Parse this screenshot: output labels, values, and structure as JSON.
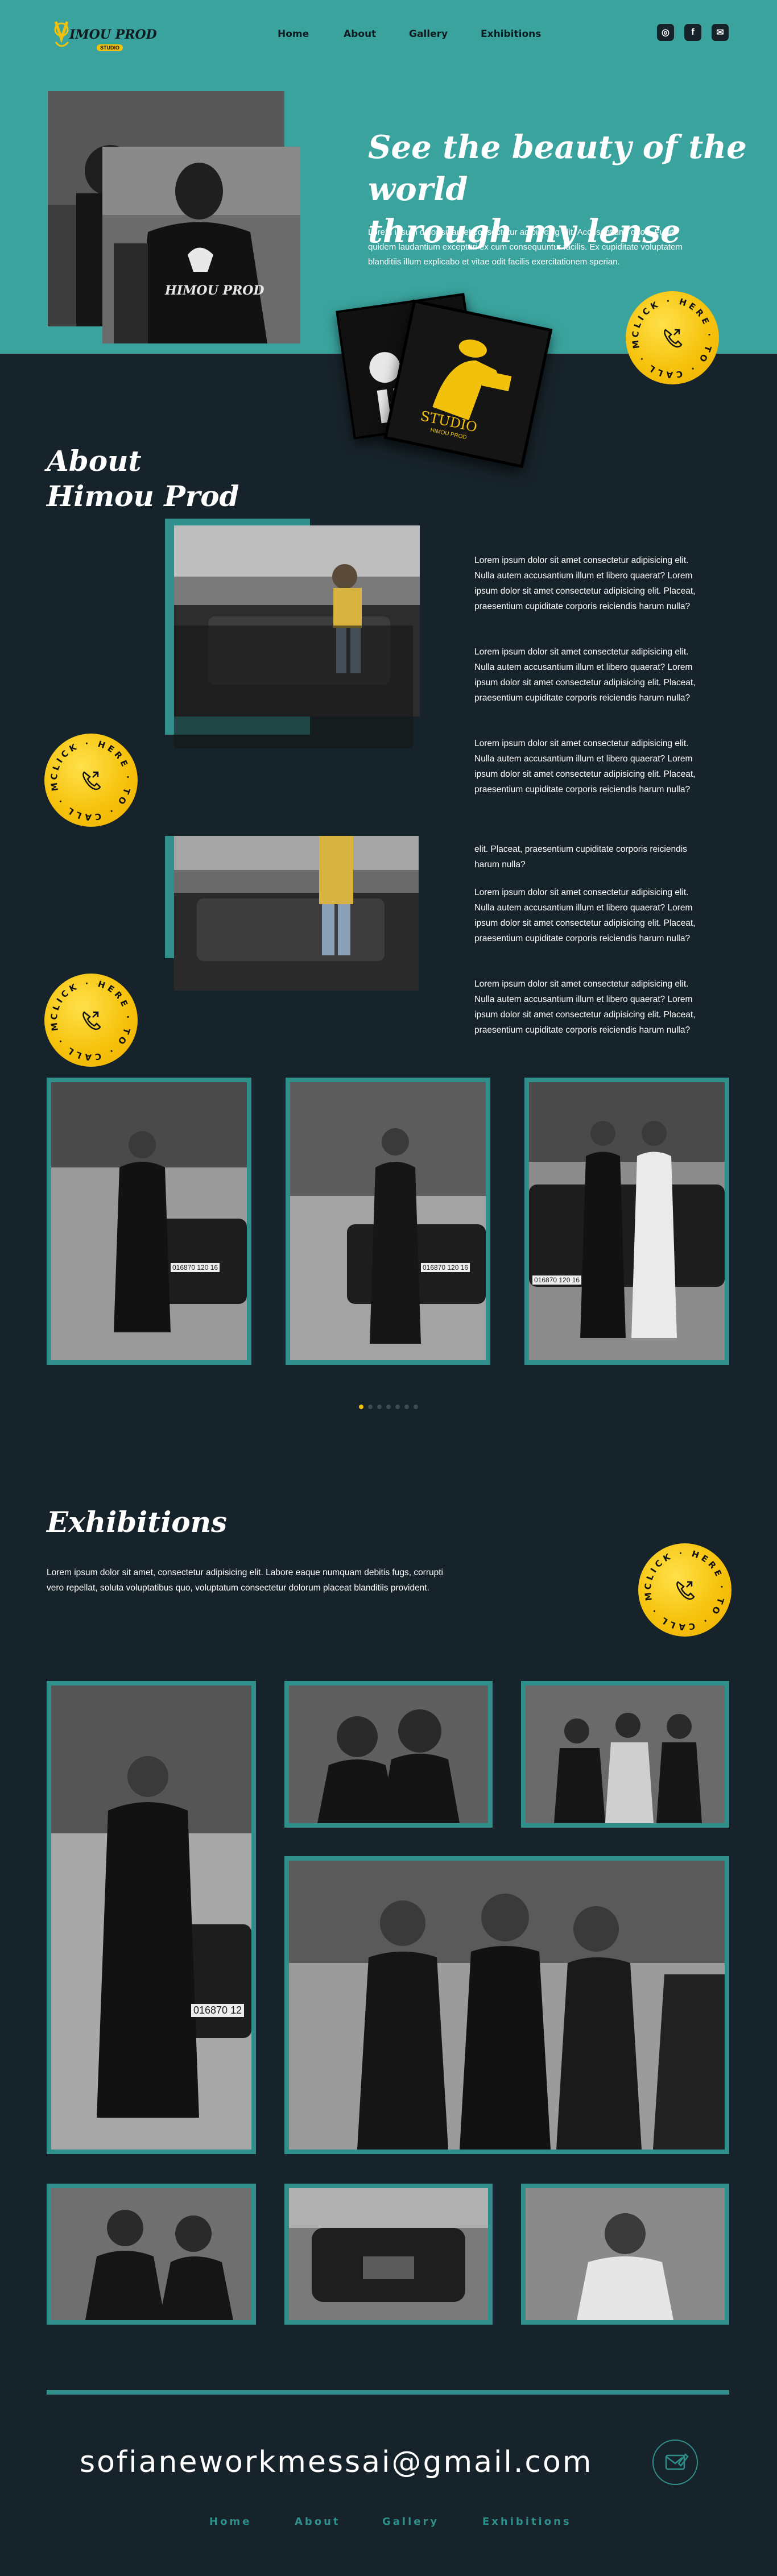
{
  "brand": {
    "logo_text": "IMOU PROD",
    "logo_sub": "STUDIO"
  },
  "nav": {
    "items": [
      {
        "label": "Home"
      },
      {
        "label": "About"
      },
      {
        "label": "Gallery"
      },
      {
        "label": "Exhibitions"
      }
    ]
  },
  "social": [
    {
      "icon": "instagram-icon",
      "glyph": "◎"
    },
    {
      "icon": "facebook-icon",
      "glyph": "f"
    },
    {
      "icon": "email-icon",
      "glyph": "✉"
    }
  ],
  "hero": {
    "title_line1": "See the beauty of the world",
    "title_line2": "through my lense",
    "text": "Lorem ipsum dolor sit amet consectetur adipisicing elit. Accusantium, quod. Fugit quidem laudantium excepturi ex cum consequuntur facilis. Ex cupiditate voluptatem blanditiis illum explicabo et vitae odit facilis exercitationem sperian.",
    "shirt_text": "HIMOU PROD",
    "card_text": "STUDIO",
    "card_sub": "HIMOU PROD"
  },
  "call_badge": {
    "ring_text": "CLICK · HERE · TO · CALL · ME ·"
  },
  "about": {
    "title_line1": "About",
    "title_line2": "Himou Prod",
    "paragraphs_top": [
      "Lorem ipsum dolor sit amet consectetur adipisicing elit. Nulla autem accusantium illum et libero quaerat? Lorem ipsum dolor sit amet consectetur adipisicing elit. Placeat, praesentium cupiditate corporis reiciendis harum nulla?",
      "Lorem ipsum dolor sit amet consectetur adipisicing elit. Nulla autem accusantium illum et libero quaerat? Lorem ipsum dolor sit amet consectetur adipisicing elit. Placeat, praesentium cupiditate corporis reiciendis harum nulla?",
      "Lorem ipsum dolor sit amet consectetur adipisicing elit. Nulla autem accusantium illum et libero quaerat? Lorem ipsum dolor sit amet consectetur adipisicing elit. Placeat, praesentium cupiditate corporis reiciendis harum nulla?"
    ],
    "partial_line": "elit. Placeat, praesentium cupiditate corporis reiciendis harum nulla?",
    "paragraphs_bottom": [
      "Lorem ipsum dolor sit amet consectetur adipisicing elit. Nulla autem accusantium illum et libero quaerat? Lorem ipsum dolor sit amet consectetur adipisicing elit. Placeat, praesentium cupiditate corporis reiciendis harum nulla?",
      "Lorem ipsum dolor sit amet consectetur adipisicing elit. Nulla autem accusantium illum et libero quaerat? Lorem ipsum dolor sit amet consectetur adipisicing elit. Placeat, praesentium cupiditate corporis reiciendis harum nulla?"
    ]
  },
  "gallery": {
    "plates": [
      "016870 120 16",
      "016870 120 16",
      "016870 120 16"
    ],
    "dots": 7,
    "active_dot": 0
  },
  "exhibitions": {
    "title": "Exhibitions",
    "text": "Lorem ipsum dolor sit amet, consectetur adipisicing elit. Labore eaque numquam debitis fugs, corrupti vero repellat, soluta voluptatibus quo, voluptatum consectetur dolorum placeat blanditiis provident.",
    "plate_large": "016870 12"
  },
  "footer": {
    "email": "sofianeworkmessai@gmail.com",
    "links": [
      {
        "label": "Home"
      },
      {
        "label": "About"
      },
      {
        "label": "Gallery"
      },
      {
        "label": "Exhibitions"
      }
    ]
  },
  "colors": {
    "teal": "#3aa39e",
    "dark": "#17232a",
    "yellow": "#f2c10c",
    "frame": "#2f8f8b"
  }
}
